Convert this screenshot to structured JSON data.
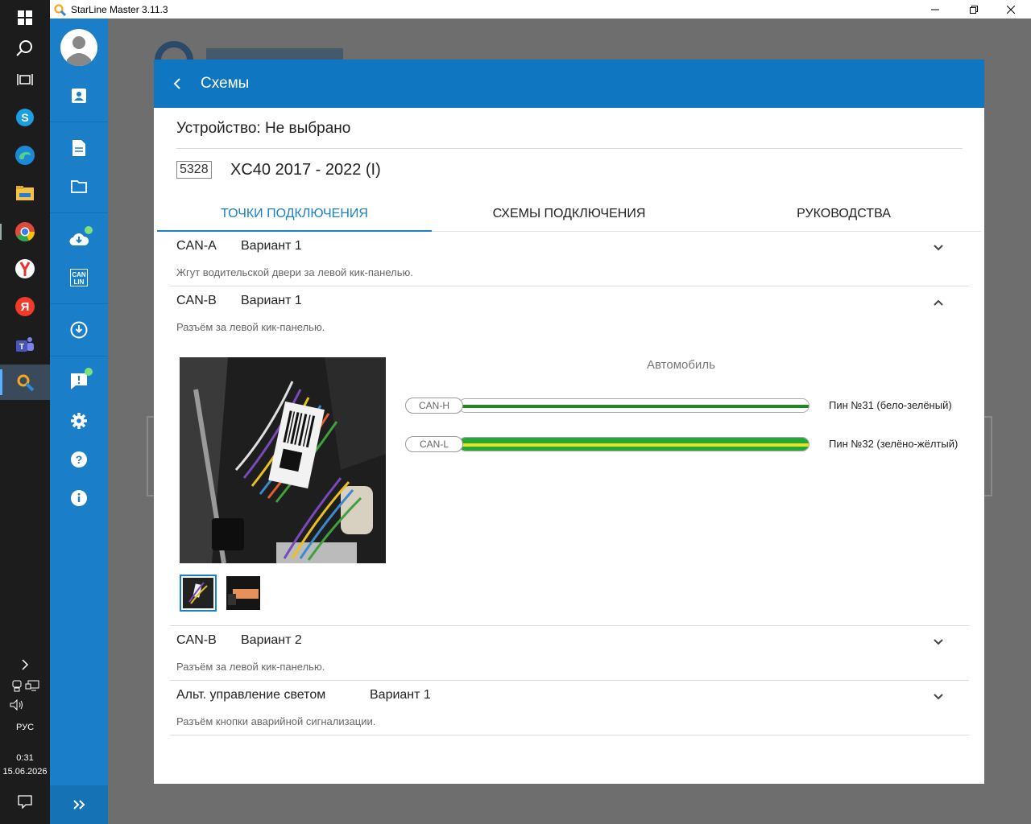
{
  "window": {
    "title": "StarLine Master 3.11.3"
  },
  "taskbar": {
    "language": "РУС",
    "time": "0:31",
    "date": "15.06.2026"
  },
  "dialog": {
    "header_title": "Схемы",
    "device_label": "Устройство: Не выбрано",
    "model_code": "5328",
    "model_name": "XC40 2017 - 2022 (I)",
    "tabs": [
      {
        "label": "ТОЧКИ ПОДКЛЮЧЕНИЯ",
        "active": true
      },
      {
        "label": "СХЕМЫ ПОДКЛЮЧЕНИЯ",
        "active": false
      },
      {
        "label": "РУКОВОДСТВА",
        "active": false
      }
    ],
    "points": [
      {
        "name": "CAN-A",
        "variant": "Вариант 1",
        "description": "Жгут водительской двери за левой кик-панелью.",
        "expanded": false
      },
      {
        "name": "CAN-B",
        "variant": "Вариант 1",
        "description": "Разъём за левой кик-панелью.",
        "expanded": true
      },
      {
        "name": "CAN-B",
        "variant": "Вариант 2",
        "description": "Разъём за левой кик-панелью.",
        "expanded": false
      },
      {
        "name": "Альт. управление светом",
        "variant": "Вариант 1",
        "description": "Разъём кнопки аварийной сигнализации.",
        "expanded": false
      }
    ],
    "expanded_detail": {
      "side_label": "Автомобиль",
      "wires": [
        {
          "tag": "CAN-H",
          "pin": "Пин №31 (бело-зелёный)",
          "base_color": "#ffffff",
          "stripe_color": "#1e8a1e"
        },
        {
          "tag": "CAN-L",
          "pin": "Пин №32 (зелёно-жёлтый)",
          "base_color": "#25a83a",
          "stripe_color": "#f0e020"
        }
      ]
    }
  },
  "colors": {
    "accent": "#0f76c2",
    "sidebar": "#1a7fc8",
    "tab_active": "#1a80c8"
  }
}
